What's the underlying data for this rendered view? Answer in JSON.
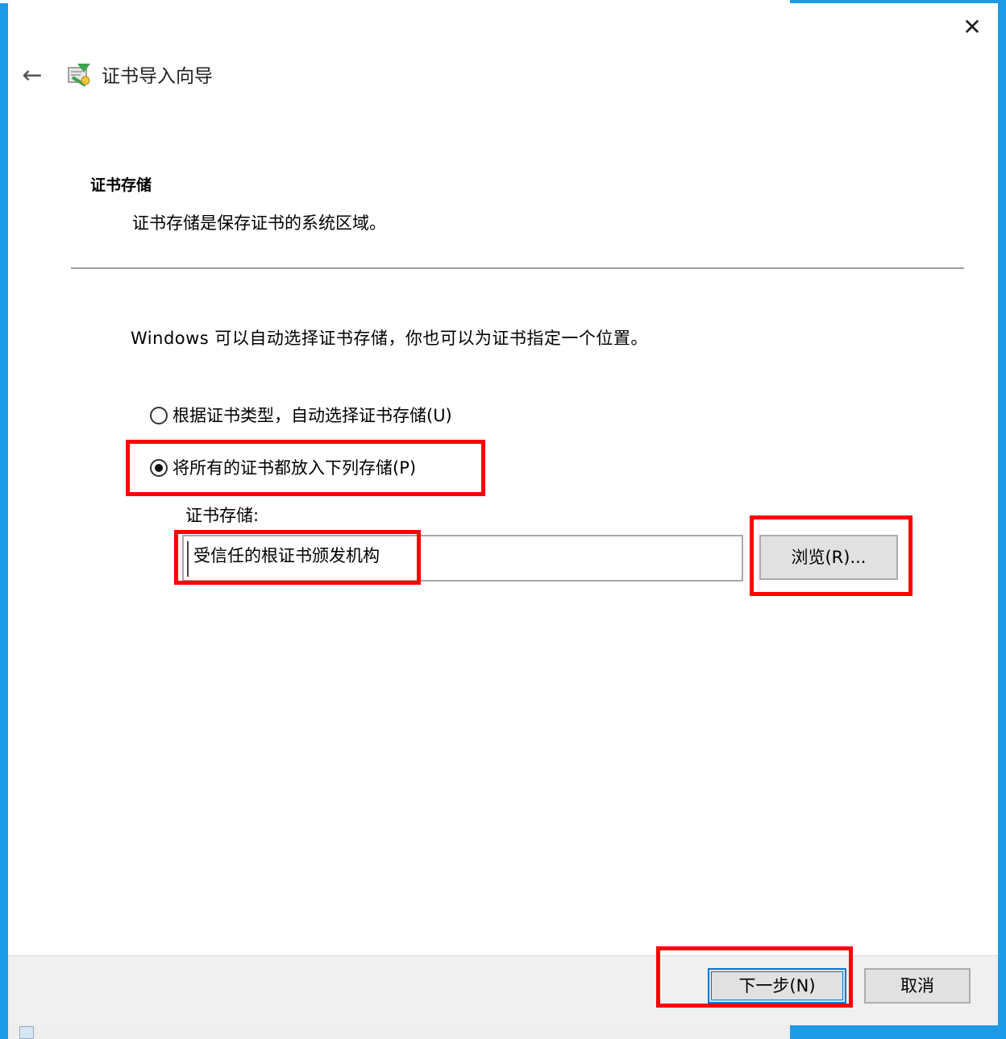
{
  "window": {
    "close_symbol": "✕",
    "back_symbol": "←"
  },
  "wizard": {
    "title": "证书导入向导",
    "icon": "certificate-wizard-icon"
  },
  "section": {
    "heading": "证书存储",
    "description": "证书存储是保存证书的系统区域。"
  },
  "intro": "Windows 可以自动选择证书存储，你也可以为证书指定一个位置。",
  "options": [
    {
      "label": "根据证书类型，自动选择证书存储(U)",
      "selected": false
    },
    {
      "label": "将所有的证书都放入下列存储(P)",
      "selected": true
    }
  ],
  "store": {
    "label": "证书存储:",
    "value": "受信任的根证书颁发机构",
    "browse_label": "浏览(R)..."
  },
  "footer": {
    "next_label": "下一步(N)",
    "cancel_label": "取消"
  },
  "colors": {
    "highlight": "#ff0000",
    "desktop": "#1e9be8",
    "focus": "#0078d7"
  }
}
